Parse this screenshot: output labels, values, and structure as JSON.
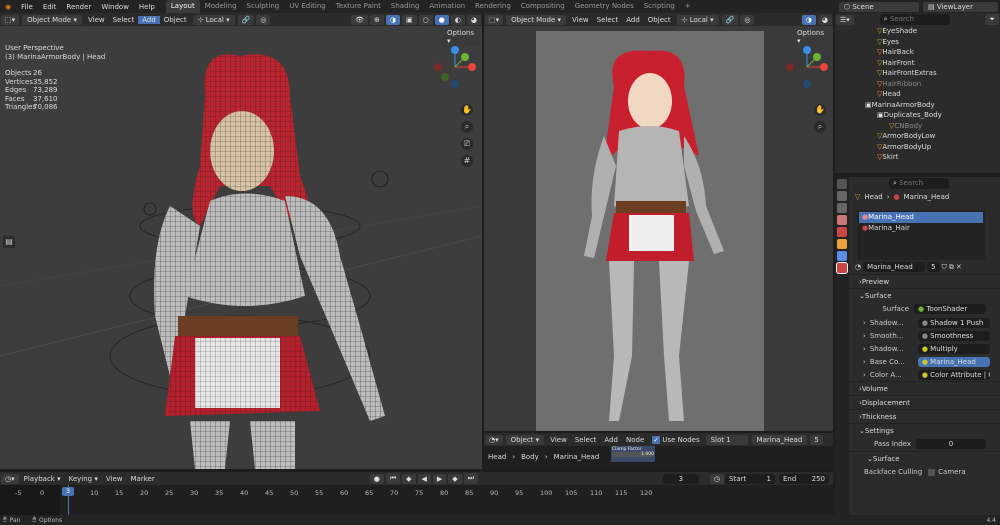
{
  "topbar": {
    "menus": [
      "File",
      "Edit",
      "Render",
      "Window",
      "Help"
    ],
    "workspaces": [
      "Layout",
      "Modeling",
      "Sculpting",
      "UV Editing",
      "Texture Paint",
      "Shading",
      "Animation",
      "Rendering",
      "Compositing",
      "Geometry Nodes",
      "Scripting"
    ],
    "active_workspace": "Layout",
    "add_tab": "+",
    "scene": "Scene",
    "view_layer": "ViewLayer"
  },
  "left_view": {
    "mode": "Object Mode",
    "menus": [
      "View",
      "Select",
      "Add",
      "Object"
    ],
    "transform": "Local",
    "options": "Options",
    "perspective": "User Perspective",
    "object_label": "(3) MarinaArmorBody | Head",
    "stats": [
      {
        "k": "Objects",
        "v": "26"
      },
      {
        "k": "Vertices",
        "v": "35,852"
      },
      {
        "k": "Edges",
        "v": "73,289"
      },
      {
        "k": "Faces",
        "v": "37,610"
      },
      {
        "k": "Triangles",
        "v": "70,086"
      }
    ]
  },
  "right_view": {
    "mode": "Object Mode",
    "menus": [
      "View",
      "Select",
      "Add",
      "Object"
    ],
    "transform": "Local",
    "options": "Options"
  },
  "node_editor": {
    "type": "Object",
    "menus": [
      "View",
      "Select",
      "Add",
      "Node"
    ],
    "use_nodes": "Use Nodes",
    "slot": "Slot 1",
    "material": "Marina_Head",
    "users": "5",
    "breadcrumb": [
      "Head",
      "Body",
      "Marina_Head"
    ],
    "node_title": "Clamp Factor",
    "node_value": "1.000"
  },
  "outliner": {
    "search_placeholder": "Search",
    "items": [
      "EyeShade",
      "Eyes",
      "HairBack",
      "HairFront",
      "HairFrontExtras",
      "HairRibbon",
      "Head",
      "MarinaArmorBody",
      "Duplicates_Body",
      "CNBody",
      "ArmorBodyLow",
      "ArmorBodyUp",
      "Skirt"
    ]
  },
  "properties": {
    "search_placeholder": "Search",
    "breadcrumb": [
      "Head",
      "Marina_Head"
    ],
    "slots": [
      "Marina_Head",
      "Marina_Hair"
    ],
    "material_name": "Marina_Head",
    "users": "5",
    "panels": {
      "preview": "Preview",
      "surface": "Surface",
      "volume": "Volume",
      "displacement": "Displacement",
      "thickness": "Thickness",
      "settings": "Settings",
      "surface_sub": "Surface"
    },
    "surface_label": "Surface",
    "surface_value": "ToonShader",
    "inputs": [
      {
        "k": "Shadow...",
        "v": "Shadow 1 Push",
        "c": "#8a8a8a"
      },
      {
        "k": "Smooth...",
        "v": "Smoothness",
        "c": "#8a8a8a"
      },
      {
        "k": "Shadow...",
        "v": "Multiply",
        "c": "#c7c729"
      },
      {
        "k": "Base Co...",
        "v": "Marina_Head",
        "c": "#c7c729"
      },
      {
        "k": "Color A...",
        "v": "Color Attribute | Color",
        "c": "#c7c729"
      }
    ],
    "pass_index_label": "Pass Index",
    "pass_index": "0",
    "backface_label": "Backface Culling",
    "camera_label": "Camera"
  },
  "timeline": {
    "menus": [
      "Playback",
      "Keying",
      "View",
      "Marker"
    ],
    "current_frame": "3",
    "start_label": "Start",
    "start": "1",
    "end_label": "End",
    "end": "250",
    "ticks": [
      "-5",
      "0",
      "5",
      "10",
      "15",
      "20",
      "25",
      "30",
      "35",
      "40",
      "45",
      "50",
      "55",
      "60",
      "65",
      "70",
      "75",
      "80",
      "85",
      "90",
      "95",
      "100",
      "105",
      "110",
      "115",
      "120"
    ]
  },
  "statusbar": {
    "pan": "Pan",
    "options": "Options",
    "version": "4.4"
  },
  "colors": {
    "accent": "#4772b3",
    "bg": "#1d1d1d",
    "panel": "#2b2b2b",
    "x_axis": "#e8443a",
    "y_axis": "#6bb536",
    "z_axis": "#3b8ee8"
  }
}
